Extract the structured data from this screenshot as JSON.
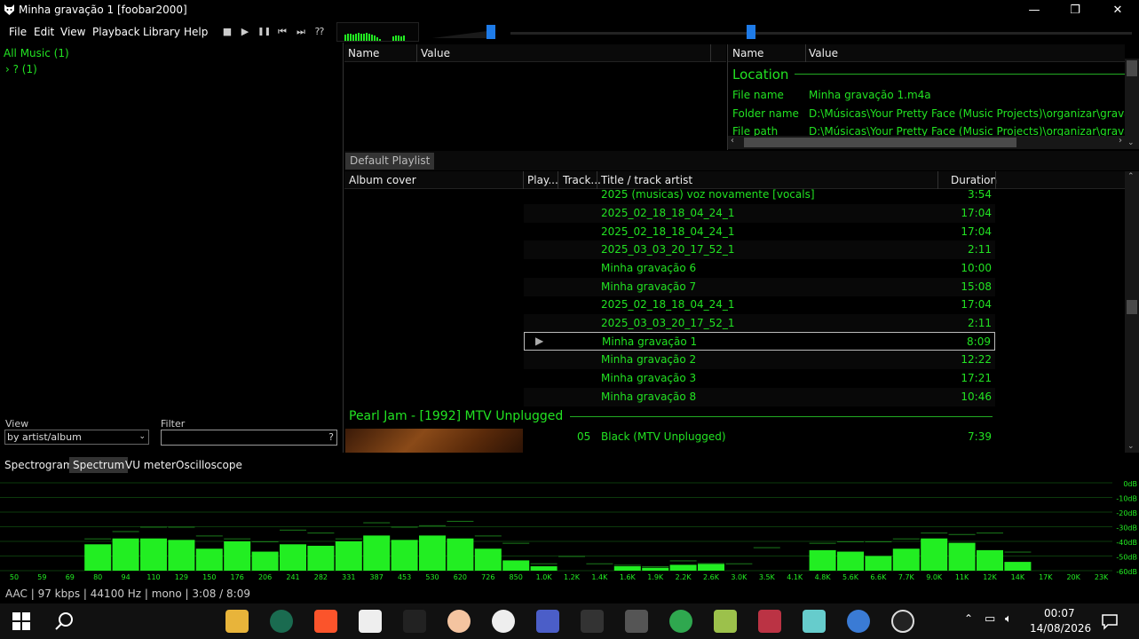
{
  "window": {
    "title": "Minha gravação 1  [foobar2000]",
    "controls": {
      "minimize": "—",
      "maximize": "❐",
      "close": "✕"
    }
  },
  "menu": [
    "File",
    "Edit",
    "View",
    "Playback",
    "Library",
    "Help"
  ],
  "toolbar": {
    "stop": "■",
    "play": "▶",
    "pause": "❚❚",
    "prev": "⏮",
    "next": "⏭",
    "random": "⁇"
  },
  "library": {
    "root": "All Music (1)",
    "child": "› ? (1)",
    "view_label": "View",
    "view_value": "by artist/album",
    "filter_label": "Filter",
    "filter_help": "?"
  },
  "properties_left": {
    "col1": "Name",
    "col2": "Value"
  },
  "properties_right": {
    "col1": "Name",
    "col2": "Value",
    "section": "Location",
    "rows": [
      {
        "name": "File name",
        "value": "Minha gravação 1.m4a"
      },
      {
        "name": "Folder name",
        "value": "D:\\Músicas\\Your Pretty Face (Music Projects)\\organizar\\gravações g"
      },
      {
        "name": "File path",
        "value": "D:\\Músicas\\Your Pretty Face (Music Projects)\\organizar\\gravações g"
      }
    ]
  },
  "playlist": {
    "tab": "Default Playlist",
    "columns": {
      "cover": "Album cover",
      "play": "Play...",
      "track": "Track...",
      "title": "Title / track artist",
      "duration": "Duration"
    },
    "rows": [
      {
        "title": "2025 (musicas) voz novamente [vocals]",
        "duration": "3:54"
      },
      {
        "title": "2025_02_18_18_04_24_1",
        "duration": "17:04"
      },
      {
        "title": "2025_02_18_18_04_24_1",
        "duration": "17:04"
      },
      {
        "title": "2025_03_03_20_17_52_1",
        "duration": "2:11"
      },
      {
        "title": "Minha gravação 6",
        "duration": "10:00"
      },
      {
        "title": "Minha gravação 7",
        "duration": "15:08"
      },
      {
        "title": "2025_02_18_18_04_24_1",
        "duration": "17:04"
      },
      {
        "title": "2025_03_03_20_17_52_1",
        "duration": "2:11"
      },
      {
        "title": "Minha gravação 1",
        "duration": "8:09",
        "playing": "▶"
      },
      {
        "title": "Minha gravação 2",
        "duration": "12:22"
      },
      {
        "title": "Minha gravação 3",
        "duration": "17:21"
      },
      {
        "title": "Minha gravação 8",
        "duration": "10:46"
      }
    ],
    "group": "Pearl Jam - [1992] MTV Unplugged",
    "group_row": {
      "track": "05",
      "title": "Black (MTV Unplugged)",
      "duration": "7:39"
    }
  },
  "vis_tabs": [
    "Spectrogram",
    "Spectrum",
    "VU meter",
    "Oscilloscope"
  ],
  "spectrum": {
    "db_labels": [
      "0dB",
      "-10dB",
      "-20dB",
      "-30dB",
      "-40dB",
      "-50dB",
      "-60dB"
    ],
    "freq_labels": [
      "50",
      "59",
      "69",
      "80",
      "94",
      "110",
      "129",
      "150",
      "176",
      "206",
      "241",
      "282",
      "331",
      "387",
      "453",
      "530",
      "620",
      "726",
      "850",
      "1.0K",
      "1.2K",
      "1.4K",
      "1.6K",
      "1.9K",
      "2.2K",
      "2.6K",
      "3.0K",
      "3.5K",
      "4.1K",
      "4.8K",
      "5.6K",
      "6.6K",
      "7.7K",
      "9.0K",
      "11K",
      "12K",
      "14K",
      "17K",
      "20K",
      "23K"
    ],
    "levels_db": [
      -60,
      -60,
      -60,
      -42,
      -38,
      -38,
      -39,
      -45,
      -40,
      -47,
      -42,
      -43,
      -40,
      -36,
      -39,
      -36,
      -38,
      -45,
      -53,
      -57,
      -60,
      -60,
      -57,
      -58,
      -56,
      -55,
      -60,
      -60,
      -60,
      -46,
      -47,
      -50,
      -45,
      -38,
      -41,
      -46,
      -54,
      -60,
      -60,
      -60
    ],
    "peaks_db": [
      -60,
      -60,
      -60,
      -38,
      -33,
      -30,
      -30,
      -36,
      -38,
      -40,
      -32,
      -34,
      -38,
      -27,
      -30,
      -29,
      -26,
      -36,
      -41,
      -55,
      -50,
      -55,
      -56,
      -57,
      -53,
      -55,
      -55,
      -44,
      -60,
      -41,
      -40,
      -40,
      -38,
      -34,
      -35,
      -34,
      -47,
      -60,
      -60,
      -60
    ],
    "color": "#22ee22"
  },
  "status": "AAC | 97 kbps | 44100 Hz | mono | 3:08 / 8:09",
  "taskbar": {
    "time": "00:07",
    "date": "14/08/2026"
  }
}
